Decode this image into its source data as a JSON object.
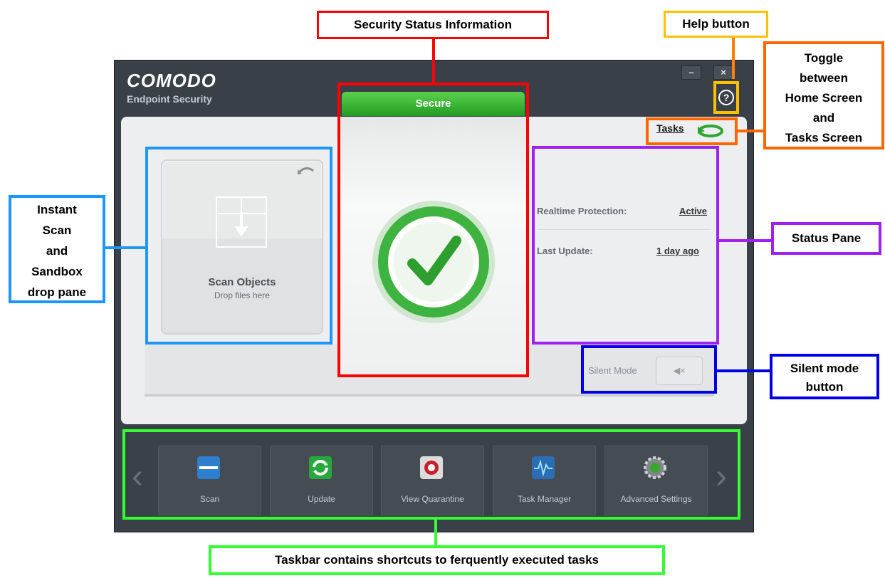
{
  "app": {
    "brand": "COMODO",
    "product": "Endpoint Security",
    "minimize_label": "–",
    "close_label": "×",
    "help_label": "?",
    "tasks_label": "Tasks"
  },
  "status": {
    "header": "Secure",
    "rows": [
      {
        "label": "Realtime Protection:",
        "value": "Active"
      },
      {
        "label": "Last Update:",
        "value": "1 day ago"
      }
    ],
    "silent_mode_label": "Silent Mode",
    "silent_mode_button": "◀×"
  },
  "scan_pane": {
    "title": "Scan Objects",
    "subtitle": "Drop files here"
  },
  "taskbar": {
    "items": [
      {
        "label": "Scan",
        "icon": "scan-icon",
        "color": "#2f7fcf"
      },
      {
        "label": "Update",
        "icon": "update-icon",
        "color": "#27a83a"
      },
      {
        "label": "View Quarantine",
        "icon": "quarantine-icon",
        "color": "#c8202a"
      },
      {
        "label": "Task Manager",
        "icon": "task-manager-icon",
        "color": "#2a6fb6"
      },
      {
        "label": "Advanced Settings",
        "icon": "gear-icon",
        "color": "#7f868c"
      }
    ]
  },
  "annotations": {
    "security_status": "Security Status Information",
    "help_button": "Help button",
    "toggle": [
      "Toggle",
      "between",
      "Home Screen",
      "and",
      "Tasks Screen"
    ],
    "scan_pane": [
      "Instant",
      "Scan",
      "and",
      "Sandbox",
      "drop pane"
    ],
    "status_pane": "Status Pane",
    "silent_mode": [
      "Silent mode",
      "button"
    ],
    "taskbar": "Taskbar contains shortcuts to ferquently executed tasks"
  },
  "colors": {
    "red": "#ff0000",
    "yellow": "#ffc000",
    "orange": "#ff6600",
    "light_blue": "#1e96ff",
    "purple": "#a020f0",
    "blue": "#0000e6",
    "green": "#33ff33",
    "secure_green": "#229c23"
  }
}
